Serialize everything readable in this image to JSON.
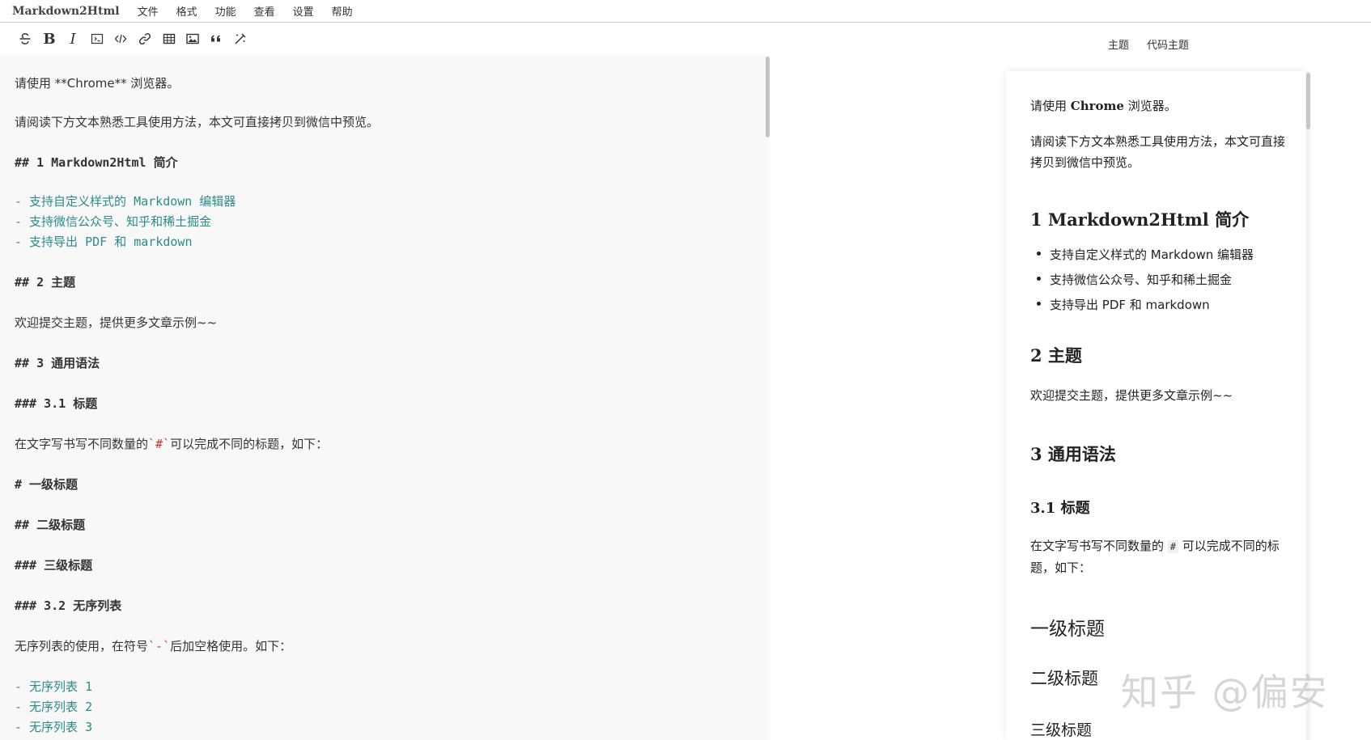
{
  "app": {
    "title": "Markdown2Html"
  },
  "menu": [
    "文件",
    "格式",
    "功能",
    "查看",
    "设置",
    "帮助"
  ],
  "toolbar": {
    "icons": [
      "strikethrough-icon",
      "bold-icon",
      "italic-icon",
      "inline-code-icon",
      "code-block-icon",
      "link-icon",
      "table-icon",
      "image-icon",
      "quote-icon",
      "format-icon"
    ],
    "bold_label": "B",
    "italic_label": "I",
    "theme_label": "主题",
    "code_theme_label": "代码主题"
  },
  "editor": {
    "lines": [
      {
        "text": "请使用 **Chrome** 浏览器。",
        "kind": "text"
      },
      {
        "text": "请阅读下方文本熟悉工具使用方法，本文可直接拷贝到微信中预览。",
        "kind": "text"
      },
      {
        "text": "## 1 Markdown2Html 简介",
        "kind": "heading"
      },
      {
        "text": "- 支持自定义样式的 Markdown 编辑器",
        "kind": "list"
      },
      {
        "text": "- 支持微信公众号、知乎和稀土掘金",
        "kind": "list"
      },
      {
        "text": "- 支持导出 PDF 和 markdown",
        "kind": "list"
      },
      {
        "text": "## 2 主题",
        "kind": "heading"
      },
      {
        "text": "欢迎提交主题，提供更多文章示例~~",
        "kind": "text"
      },
      {
        "text": "## 3 通用语法",
        "kind": "heading"
      },
      {
        "text": "### 3.1 标题",
        "kind": "heading"
      },
      {
        "text_before": "在文字写书写不同数量的",
        "code": "`#`",
        "text_after": "可以完成不同的标题，如下：",
        "kind": "inline-code"
      },
      {
        "text": "# 一级标题",
        "kind": "heading"
      },
      {
        "text": "## 二级标题",
        "kind": "heading"
      },
      {
        "text": "### 三级标题",
        "kind": "heading"
      },
      {
        "text": "### 3.2 无序列表",
        "kind": "heading"
      },
      {
        "text_before": "无序列表的使用，在符号",
        "code": "`-`",
        "text_after": "后加空格使用。如下：",
        "kind": "inline-code"
      },
      {
        "text": "- 无序列表 1",
        "kind": "list"
      },
      {
        "text": "- 无序列表 2",
        "kind": "list"
      },
      {
        "text": "- 无序列表 3",
        "kind": "list"
      }
    ]
  },
  "preview": {
    "p1_before": "请使用 ",
    "p1_bold": "Chrome",
    "p1_after": " 浏览器。",
    "p2": "请阅读下方文本熟悉工具使用方法，本文可直接拷贝到微信中预览。",
    "h_intro": "1 Markdown2Html 简介",
    "bullets": [
      "支持自定义样式的 Markdown 编辑器",
      "支持微信公众号、知乎和稀土掘金",
      "支持导出 PDF 和 markdown"
    ],
    "h_theme": "2 主题",
    "p_theme": "欢迎提交主题，提供更多文章示例~~",
    "h_syntax": "3 通用语法",
    "h_title": "3.1 标题",
    "p_title_before": "在文字写书写不同数量的 ",
    "p_title_code": "#",
    "p_title_after": " 可以完成不同的标题，如下：",
    "h1_demo": "一级标题",
    "h2_demo": "二级标题",
    "h3_demo": "三级标题"
  },
  "watermark": "知乎 @偏安"
}
